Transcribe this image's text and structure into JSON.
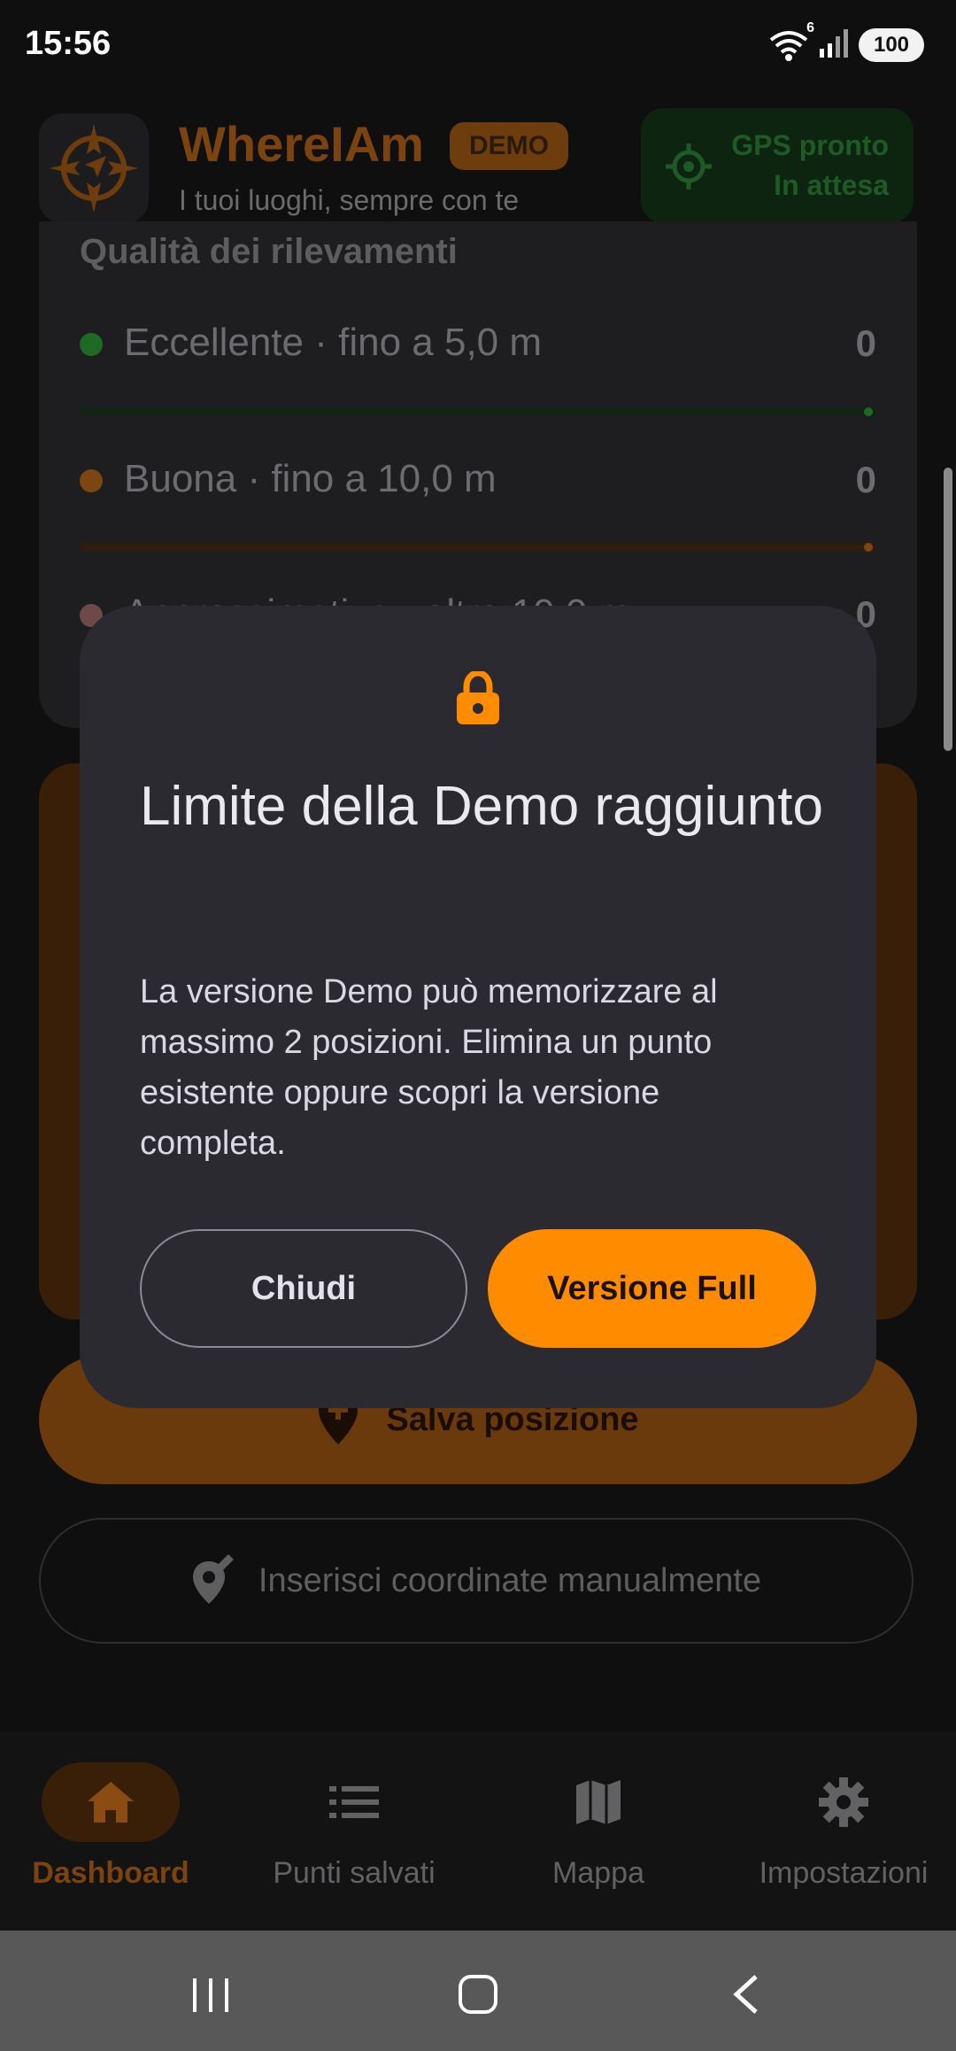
{
  "status_bar": {
    "time": "15:56",
    "battery": "100",
    "wifi_badge": "6"
  },
  "header": {
    "title": "WhereIAm",
    "badge": "DEMO",
    "subtitle": "I tuoi luoghi, sempre con te",
    "gps_status_line1": "GPS pronto",
    "gps_status_line2": "In attesa"
  },
  "quality": {
    "title": "Qualità dei rilevamenti",
    "rows": [
      {
        "label": "Eccellente · fino a 5,0 m",
        "count": "0",
        "color": "#1d6a24"
      },
      {
        "label": "Buona · fino a 10,0 m",
        "count": "0",
        "color": "#7b460f"
      },
      {
        "label": "Approssimativa · oltre 10,0 m",
        "count": "0",
        "color": "#6b4a48"
      }
    ]
  },
  "actions": {
    "save_label": "Salva posizione",
    "manual_label": "Inserisci coordinate manualmente"
  },
  "dialog": {
    "title": "Limite della Demo raggiunto",
    "body": "La versione Demo può memorizzare al massimo 2 posizioni. Elimina un punto esistente oppure scopri la versione completa.",
    "close_label": "Chiudi",
    "full_label": "Versione Full",
    "accent": "#ff8c00"
  },
  "bottom_nav": {
    "items": [
      {
        "label": "Dashboard",
        "icon": "home-icon",
        "active": true
      },
      {
        "label": "Punti salvati",
        "icon": "list-icon",
        "active": false
      },
      {
        "label": "Mappa",
        "icon": "map-icon",
        "active": false
      },
      {
        "label": "Impostazioni",
        "icon": "gear-icon",
        "active": false
      }
    ]
  }
}
